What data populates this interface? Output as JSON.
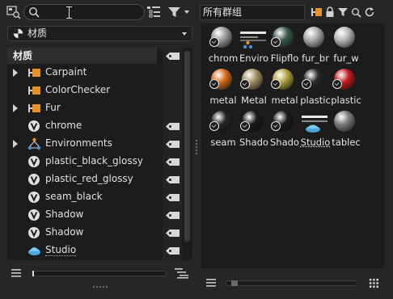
{
  "search": {
    "value": "",
    "placeholder": ""
  },
  "group_filter": {
    "value": "所有群组"
  },
  "dropdown": {
    "label": "材质"
  },
  "tree": {
    "header": "材质",
    "items": [
      {
        "label": "Carpaint",
        "icon": "folder-icon",
        "expandable": true,
        "tag": false
      },
      {
        "label": "ColorChecker",
        "icon": "folder-icon",
        "expandable": false,
        "tag": false
      },
      {
        "label": "Fur",
        "icon": "folder-icon",
        "expandable": true,
        "tag": false
      },
      {
        "label": "chrome",
        "icon": "material-v-icon",
        "expandable": false,
        "tag": true
      },
      {
        "label": "Environments",
        "icon": "network-icon",
        "expandable": true,
        "tag": true
      },
      {
        "label": "plastic_black_glossy",
        "icon": "material-v-icon",
        "expandable": false,
        "tag": true
      },
      {
        "label": "plastic_red_glossy",
        "icon": "material-v-icon",
        "expandable": false,
        "tag": true
      },
      {
        "label": "seam_black",
        "icon": "material-v-icon",
        "expandable": false,
        "tag": true
      },
      {
        "label": "Shadow",
        "icon": "material-v-icon",
        "expandable": false,
        "tag": true
      },
      {
        "label": "Shadow",
        "icon": "material-v-icon",
        "expandable": false,
        "tag": true
      },
      {
        "label": "Studio",
        "icon": "studio-icon",
        "expandable": false,
        "tag": true
      }
    ]
  },
  "grid": {
    "tiles": [
      {
        "name": "chrom",
        "thumb": "ball",
        "color": "#9a9a9a",
        "mark": "v"
      },
      {
        "name": "Enviro",
        "thumb": "env",
        "color": "#888888",
        "mark": "none"
      },
      {
        "name": "Flipflo",
        "thumb": "ball",
        "color": "#3a5a4a",
        "mark": "v"
      },
      {
        "name": "fur_br",
        "thumb": "ball",
        "color": "#a8a8a8",
        "mark": "none"
      },
      {
        "name": "fur_w",
        "thumb": "ball",
        "color": "#b5b5b5",
        "mark": "none"
      },
      {
        "name": "metal",
        "thumb": "ball",
        "color": "#d66a1a",
        "mark": "v"
      },
      {
        "name": "Metal",
        "thumb": "ball",
        "color": "#a09060",
        "mark": "v"
      },
      {
        "name": "metal",
        "thumb": "ball",
        "color": "#b0a040",
        "mark": "v"
      },
      {
        "name": "plastic",
        "thumb": "ball",
        "color": "#2a2a2a",
        "mark": "v"
      },
      {
        "name": "plastic",
        "thumb": "ball",
        "color": "#c01c1c",
        "mark": "v"
      },
      {
        "name": "seam",
        "thumb": "ball",
        "color": "#252525",
        "mark": "v"
      },
      {
        "name": "Shado",
        "thumb": "ball",
        "color": "#1a1a1a",
        "mark": "v"
      },
      {
        "name": "Shado",
        "thumb": "ball",
        "color": "#1a1a1a",
        "mark": "v"
      },
      {
        "name": "Studio",
        "thumb": "studio",
        "color": "#5aa8d8",
        "mark": "none"
      },
      {
        "name": "tablec",
        "thumb": "ball",
        "color": "#7a7a7a",
        "mark": "none"
      }
    ]
  },
  "colors": {
    "accent_orange": "#e8902a",
    "panel": "#1c1c1c",
    "background": "#262626"
  },
  "icons": [
    "layers-search-icon",
    "search-icon",
    "tree-toggle-icon",
    "filter-icon",
    "bookmark-icon",
    "lock-icon",
    "funnel-icon",
    "search-small-icon",
    "refresh-icon"
  ]
}
